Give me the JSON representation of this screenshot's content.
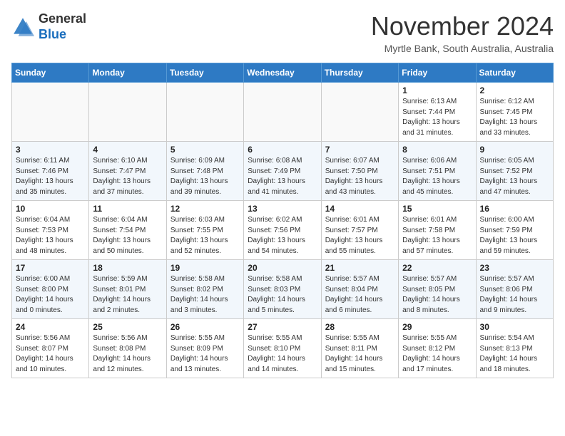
{
  "header": {
    "logo_general": "General",
    "logo_blue": "Blue",
    "month": "November 2024",
    "location": "Myrtle Bank, South Australia, Australia"
  },
  "weekdays": [
    "Sunday",
    "Monday",
    "Tuesday",
    "Wednesday",
    "Thursday",
    "Friday",
    "Saturday"
  ],
  "weeks": [
    [
      {
        "day": "",
        "info": ""
      },
      {
        "day": "",
        "info": ""
      },
      {
        "day": "",
        "info": ""
      },
      {
        "day": "",
        "info": ""
      },
      {
        "day": "",
        "info": ""
      },
      {
        "day": "1",
        "info": "Sunrise: 6:13 AM\nSunset: 7:44 PM\nDaylight: 13 hours\nand 31 minutes."
      },
      {
        "day": "2",
        "info": "Sunrise: 6:12 AM\nSunset: 7:45 PM\nDaylight: 13 hours\nand 33 minutes."
      }
    ],
    [
      {
        "day": "3",
        "info": "Sunrise: 6:11 AM\nSunset: 7:46 PM\nDaylight: 13 hours\nand 35 minutes."
      },
      {
        "day": "4",
        "info": "Sunrise: 6:10 AM\nSunset: 7:47 PM\nDaylight: 13 hours\nand 37 minutes."
      },
      {
        "day": "5",
        "info": "Sunrise: 6:09 AM\nSunset: 7:48 PM\nDaylight: 13 hours\nand 39 minutes."
      },
      {
        "day": "6",
        "info": "Sunrise: 6:08 AM\nSunset: 7:49 PM\nDaylight: 13 hours\nand 41 minutes."
      },
      {
        "day": "7",
        "info": "Sunrise: 6:07 AM\nSunset: 7:50 PM\nDaylight: 13 hours\nand 43 minutes."
      },
      {
        "day": "8",
        "info": "Sunrise: 6:06 AM\nSunset: 7:51 PM\nDaylight: 13 hours\nand 45 minutes."
      },
      {
        "day": "9",
        "info": "Sunrise: 6:05 AM\nSunset: 7:52 PM\nDaylight: 13 hours\nand 47 minutes."
      }
    ],
    [
      {
        "day": "10",
        "info": "Sunrise: 6:04 AM\nSunset: 7:53 PM\nDaylight: 13 hours\nand 48 minutes."
      },
      {
        "day": "11",
        "info": "Sunrise: 6:04 AM\nSunset: 7:54 PM\nDaylight: 13 hours\nand 50 minutes."
      },
      {
        "day": "12",
        "info": "Sunrise: 6:03 AM\nSunset: 7:55 PM\nDaylight: 13 hours\nand 52 minutes."
      },
      {
        "day": "13",
        "info": "Sunrise: 6:02 AM\nSunset: 7:56 PM\nDaylight: 13 hours\nand 54 minutes."
      },
      {
        "day": "14",
        "info": "Sunrise: 6:01 AM\nSunset: 7:57 PM\nDaylight: 13 hours\nand 55 minutes."
      },
      {
        "day": "15",
        "info": "Sunrise: 6:01 AM\nSunset: 7:58 PM\nDaylight: 13 hours\nand 57 minutes."
      },
      {
        "day": "16",
        "info": "Sunrise: 6:00 AM\nSunset: 7:59 PM\nDaylight: 13 hours\nand 59 minutes."
      }
    ],
    [
      {
        "day": "17",
        "info": "Sunrise: 6:00 AM\nSunset: 8:00 PM\nDaylight: 14 hours\nand 0 minutes."
      },
      {
        "day": "18",
        "info": "Sunrise: 5:59 AM\nSunset: 8:01 PM\nDaylight: 14 hours\nand 2 minutes."
      },
      {
        "day": "19",
        "info": "Sunrise: 5:58 AM\nSunset: 8:02 PM\nDaylight: 14 hours\nand 3 minutes."
      },
      {
        "day": "20",
        "info": "Sunrise: 5:58 AM\nSunset: 8:03 PM\nDaylight: 14 hours\nand 5 minutes."
      },
      {
        "day": "21",
        "info": "Sunrise: 5:57 AM\nSunset: 8:04 PM\nDaylight: 14 hours\nand 6 minutes."
      },
      {
        "day": "22",
        "info": "Sunrise: 5:57 AM\nSunset: 8:05 PM\nDaylight: 14 hours\nand 8 minutes."
      },
      {
        "day": "23",
        "info": "Sunrise: 5:57 AM\nSunset: 8:06 PM\nDaylight: 14 hours\nand 9 minutes."
      }
    ],
    [
      {
        "day": "24",
        "info": "Sunrise: 5:56 AM\nSunset: 8:07 PM\nDaylight: 14 hours\nand 10 minutes."
      },
      {
        "day": "25",
        "info": "Sunrise: 5:56 AM\nSunset: 8:08 PM\nDaylight: 14 hours\nand 12 minutes."
      },
      {
        "day": "26",
        "info": "Sunrise: 5:55 AM\nSunset: 8:09 PM\nDaylight: 14 hours\nand 13 minutes."
      },
      {
        "day": "27",
        "info": "Sunrise: 5:55 AM\nSunset: 8:10 PM\nDaylight: 14 hours\nand 14 minutes."
      },
      {
        "day": "28",
        "info": "Sunrise: 5:55 AM\nSunset: 8:11 PM\nDaylight: 14 hours\nand 15 minutes."
      },
      {
        "day": "29",
        "info": "Sunrise: 5:55 AM\nSunset: 8:12 PM\nDaylight: 14 hours\nand 17 minutes."
      },
      {
        "day": "30",
        "info": "Sunrise: 5:54 AM\nSunset: 8:13 PM\nDaylight: 14 hours\nand 18 minutes."
      }
    ]
  ]
}
